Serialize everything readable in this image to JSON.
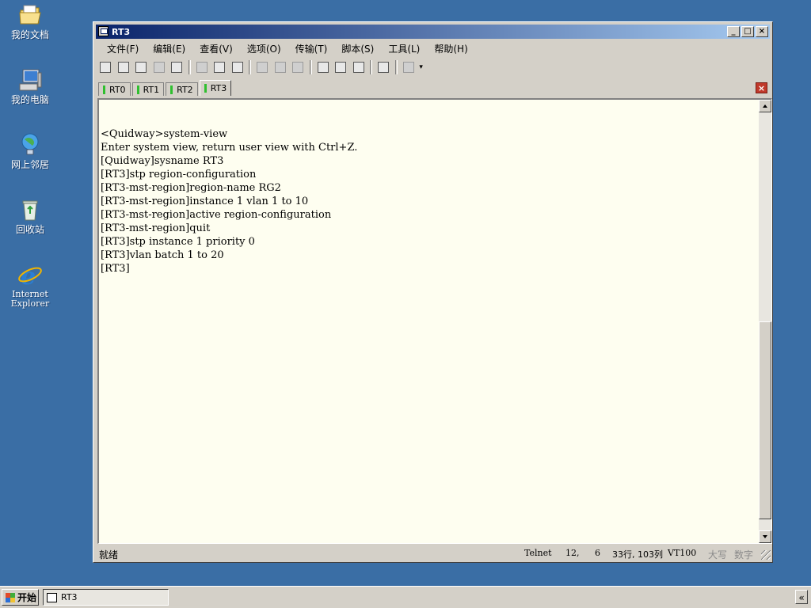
{
  "desktop": {
    "icons": [
      {
        "label": "我的文档",
        "icon": "folder-icon"
      },
      {
        "label": "我的电脑",
        "icon": "computer-icon"
      },
      {
        "label": "网上邻居",
        "icon": "network-icon"
      },
      {
        "label": "回收站",
        "icon": "recycle-bin-icon"
      },
      {
        "label_line1": "Internet",
        "label_line2": "Explorer",
        "icon": "ie-icon"
      }
    ]
  },
  "window": {
    "title": "RT3",
    "controls": {
      "minimize": "_",
      "maximize": "□",
      "close": "×"
    }
  },
  "menu": [
    "文件(F)",
    "编辑(E)",
    "查看(V)",
    "选项(O)",
    "传输(T)",
    "脚本(S)",
    "工具(L)",
    "帮助(H)"
  ],
  "tabs": [
    {
      "label": "RT0",
      "active": false
    },
    {
      "label": "RT1",
      "active": false
    },
    {
      "label": "RT2",
      "active": false
    },
    {
      "label": "RT3",
      "active": true
    }
  ],
  "terminal": {
    "lines": [
      "<Quidway>system-view",
      "Enter system view, return user view with Ctrl+Z.",
      "[Quidway]sysname RT3",
      "[RT3]stp region-configuration",
      "[RT3-mst-region]region-name RG2",
      "[RT3-mst-region]instance 1 vlan 1 to 10",
      "[RT3-mst-region]active region-configuration",
      "[RT3-mst-region]quit",
      "[RT3]stp instance 1 priority 0",
      "[RT3]vlan batch 1 to 20",
      "[RT3]"
    ]
  },
  "status": {
    "ready": "就绪",
    "protocol": "Telnet",
    "row": "12,",
    "col": "6",
    "size": "33行, 103列",
    "emulation": "VT100",
    "caps": "大写",
    "num": "数字"
  },
  "taskbar": {
    "start": "开始",
    "task": "RT3",
    "tray": "«"
  },
  "colors": {
    "desktop": "#3a6ea5",
    "title_start": "#0a246a",
    "title_end": "#a6caf0",
    "terminal_bg": "#fefef0",
    "tab_mark": "#2fbf2f"
  }
}
